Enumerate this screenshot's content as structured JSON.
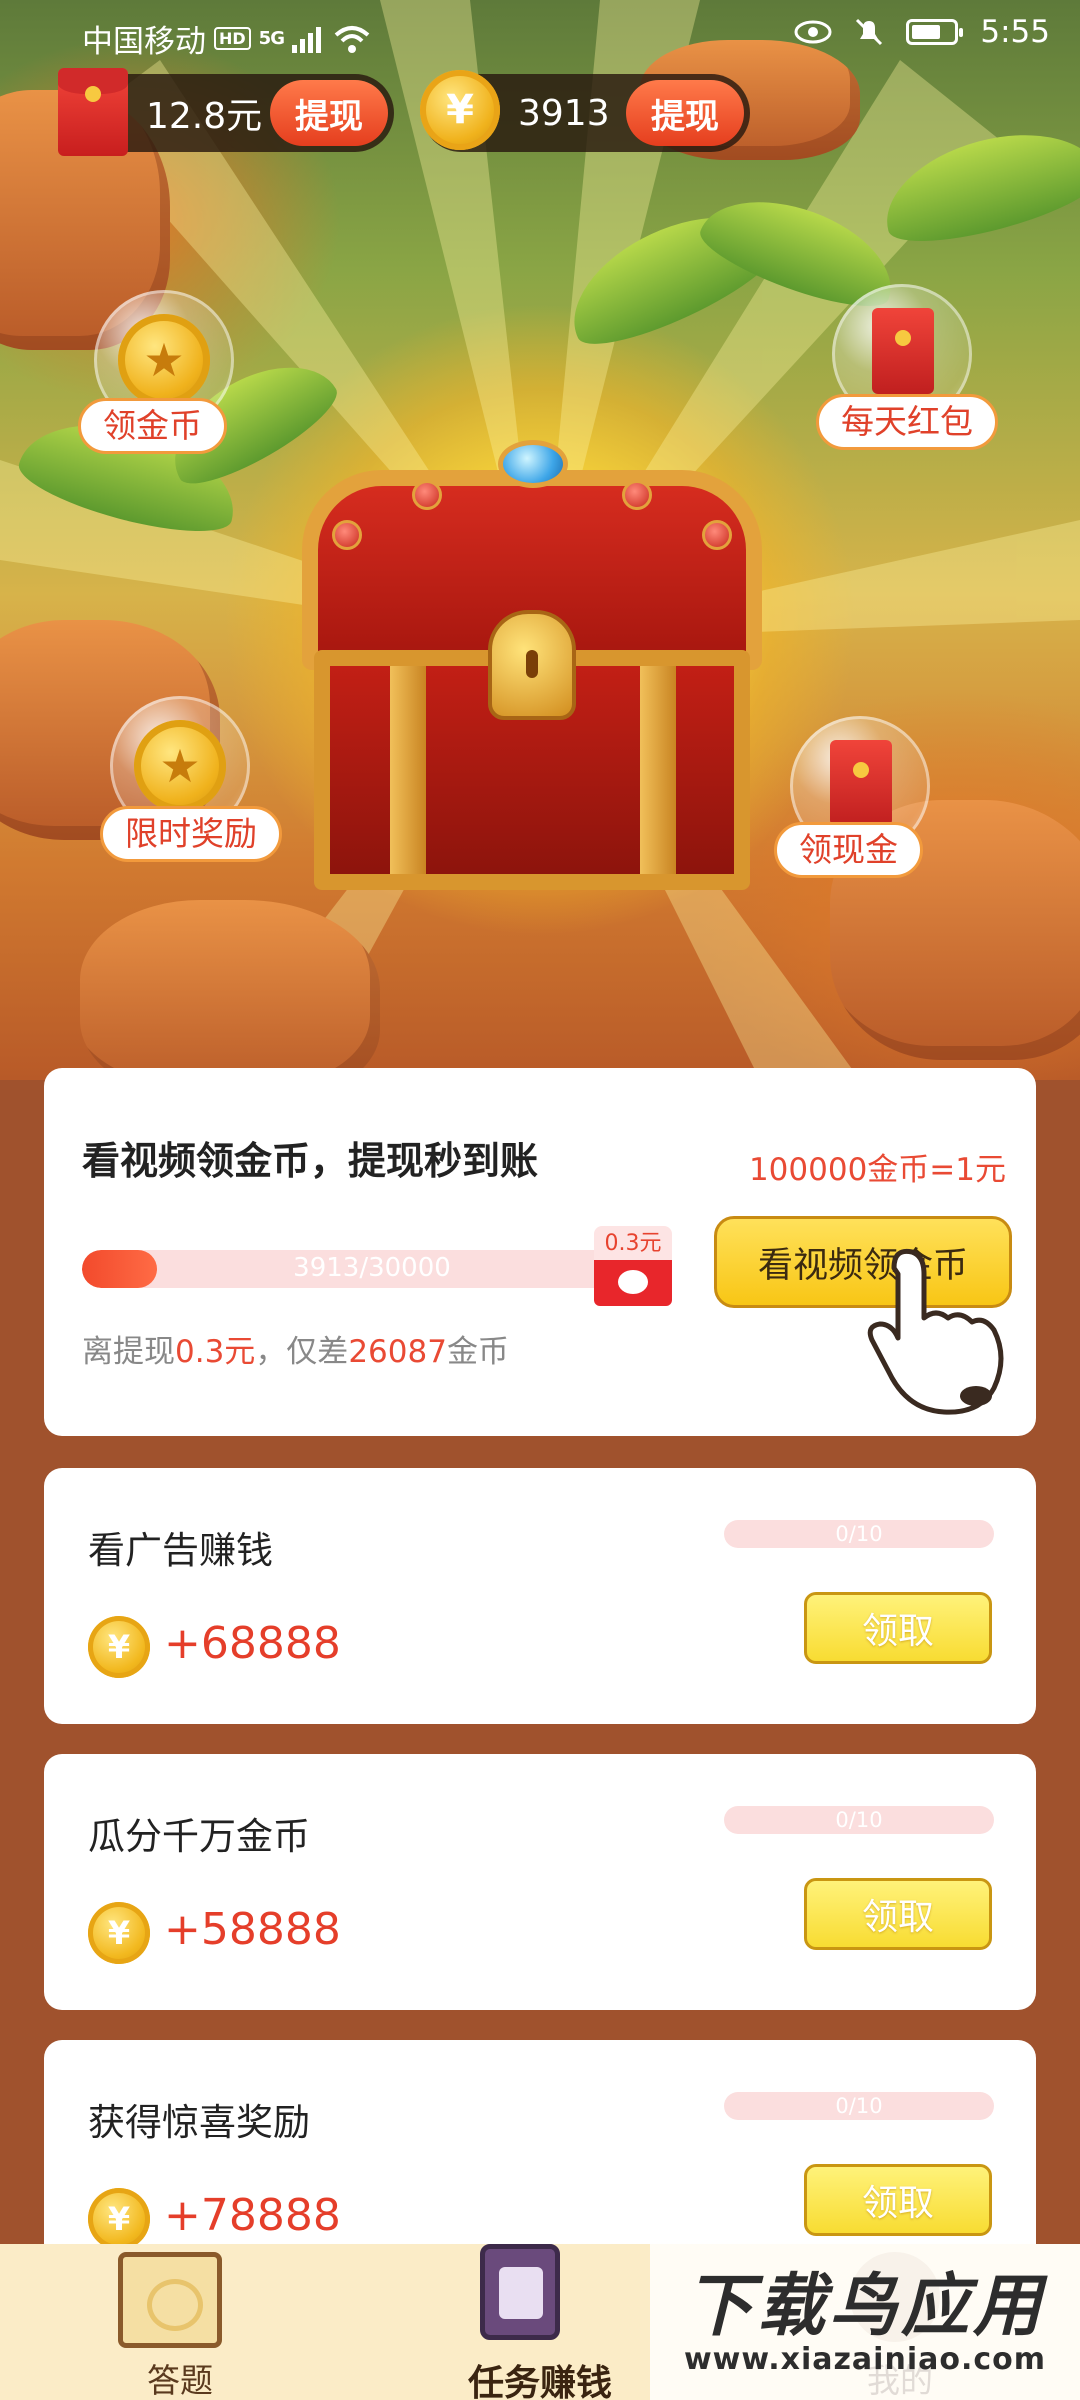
{
  "status_bar": {
    "carrier": "中国移动",
    "hd": "HD",
    "signal": "5G",
    "time": "5:55",
    "icons": [
      "wifi-icon",
      "eye-icon",
      "mute-bell-icon",
      "battery-icon"
    ]
  },
  "wallet": {
    "cash_amount": "12.8元",
    "cash_withdraw_label": "提现",
    "coin_symbol": "¥",
    "coin_amount": "3913",
    "coin_withdraw_label": "提现"
  },
  "bubbles": [
    {
      "label": "领金币",
      "icon": "coin-icon"
    },
    {
      "label": "每天红包",
      "icon": "red-envelope-icon"
    },
    {
      "label": "限时奖励",
      "icon": "coin-icon"
    },
    {
      "label": "领现金",
      "icon": "red-envelope-icon"
    }
  ],
  "main_card": {
    "title": "看视频领金币，提现秒到账",
    "rate": "100000金币=1元",
    "progress_text": "3913/30000",
    "progress_fraction": 0.13,
    "goal_tag": "0.3元",
    "watch_button": "看视频领金币",
    "deficit_prefix": "离提现",
    "deficit_amount": "0.3元",
    "deficit_middle": "，仅差",
    "deficit_coins": "26087",
    "deficit_suffix": "金币"
  },
  "tasks": [
    {
      "title": "看广告赚钱",
      "progress": "0/10",
      "reward": "+68888",
      "button": "领取"
    },
    {
      "title": "瓜分千万金币",
      "progress": "0/10",
      "reward": "+58888",
      "button": "领取"
    },
    {
      "title": "获得惊喜奖励",
      "progress": "0/10",
      "reward": "+78888",
      "button": "领取"
    }
  ],
  "bottom_nav": {
    "items": [
      {
        "label": "答题",
        "icon": "scroll-icon",
        "active": false
      },
      {
        "label": "任务赚钱",
        "icon": "task-pencil-icon",
        "active": true
      },
      {
        "label": "我的",
        "icon": "profile-icon",
        "active": false
      }
    ]
  },
  "watermark": {
    "main": "下载鸟应用",
    "sub": "www.xiazainiao.com"
  },
  "colors": {
    "background": "#a0522d",
    "accent_red": "#e53e2a",
    "button_yellow": "#f8c615",
    "nav_bg": "#fbecc7"
  }
}
